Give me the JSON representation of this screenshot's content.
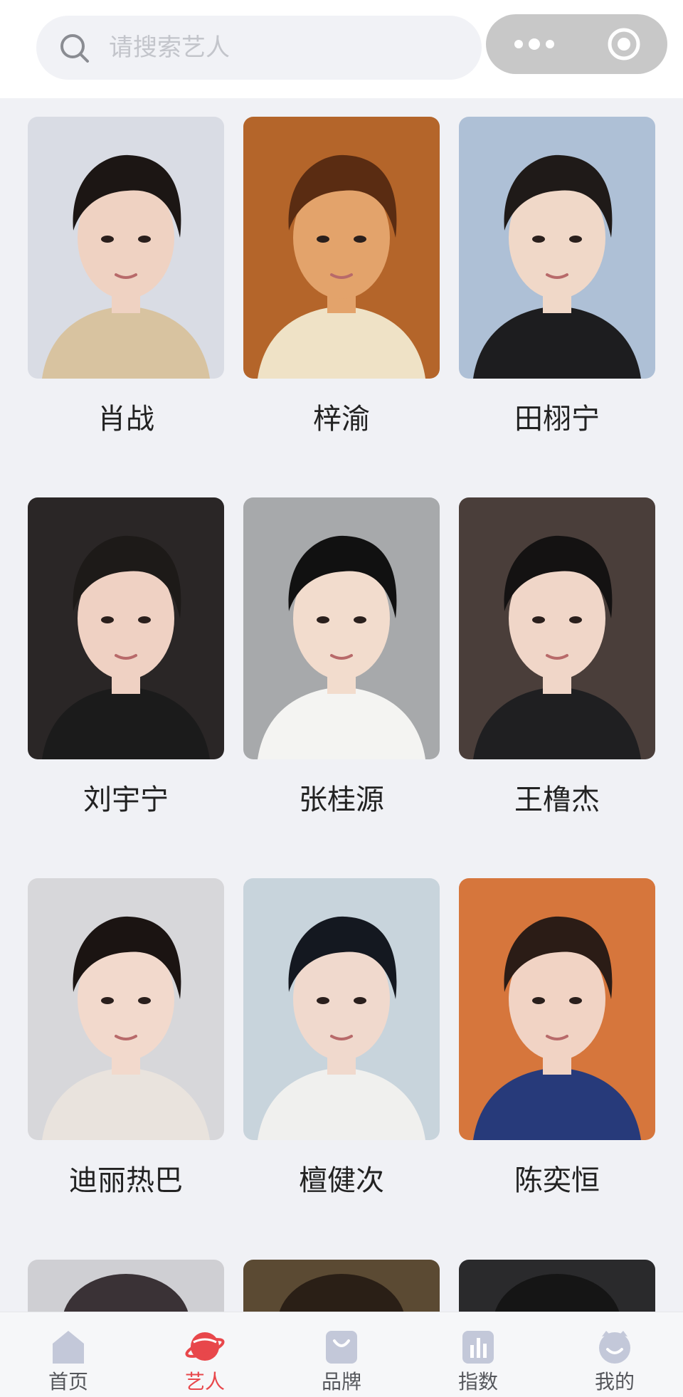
{
  "search": {
    "placeholder": "请搜索艺人"
  },
  "artists": [
    {
      "name": "肖战",
      "bg": "#d9dce4",
      "skin": "#efd2c2",
      "hair": "#1c1614",
      "cloth": "#d8c3a0"
    },
    {
      "name": "梓渝",
      "bg": "#b4652a",
      "skin": "#e3a36b",
      "hair": "#5a2c12",
      "cloth": "#efe2c6"
    },
    {
      "name": "田栩宁",
      "bg": "#aec0d6",
      "skin": "#f0d8c8",
      "hair": "#1f1a18",
      "cloth": "#1d1d1f"
    },
    {
      "name": "刘宇宁",
      "bg": "#2a2626",
      "skin": "#efd1c3",
      "hair": "#1d1a18",
      "cloth": "#1b1b1b"
    },
    {
      "name": "张桂源",
      "bg": "#a7a9ab",
      "skin": "#f2dccd",
      "hair": "#111111",
      "cloth": "#f4f4f2"
    },
    {
      "name": "王橹杰",
      "bg": "#4a3e3a",
      "skin": "#f0d6c8",
      "hair": "#141212",
      "cloth": "#1f1f21"
    },
    {
      "name": "迪丽热巴",
      "bg": "#d7d7da",
      "skin": "#f2d9cc",
      "hair": "#1b1412",
      "cloth": "#e9e3dd"
    },
    {
      "name": "檀健次",
      "bg": "#c8d4dc",
      "skin": "#f0d9cd",
      "hair": "#141820",
      "cloth": "#f0f0ee"
    },
    {
      "name": "陈奕恒",
      "bg": "#d6763c",
      "skin": "#f1d3c4",
      "hair": "#2b1c16",
      "cloth": "#273a7a"
    }
  ],
  "partial_row": [
    {
      "bg": "#cfcfd3",
      "hair": "#3a3236"
    },
    {
      "bg": "#5b4a33",
      "hair": "#2a1f16"
    },
    {
      "bg": "#2a2a2c",
      "hair": "#151515"
    }
  ],
  "tabbar": {
    "tabs": [
      {
        "label": "首页",
        "icon": "home-icon",
        "active": false
      },
      {
        "label": "艺人",
        "icon": "planet-icon",
        "active": true
      },
      {
        "label": "品牌",
        "icon": "shopping-bag-icon",
        "active": false
      },
      {
        "label": "指数",
        "icon": "bar-chart-icon",
        "active": false
      },
      {
        "label": "我的",
        "icon": "profile-face-icon",
        "active": false
      }
    ],
    "active_color": "#e8474b",
    "inactive_icon_color": "#c3c8d9"
  }
}
